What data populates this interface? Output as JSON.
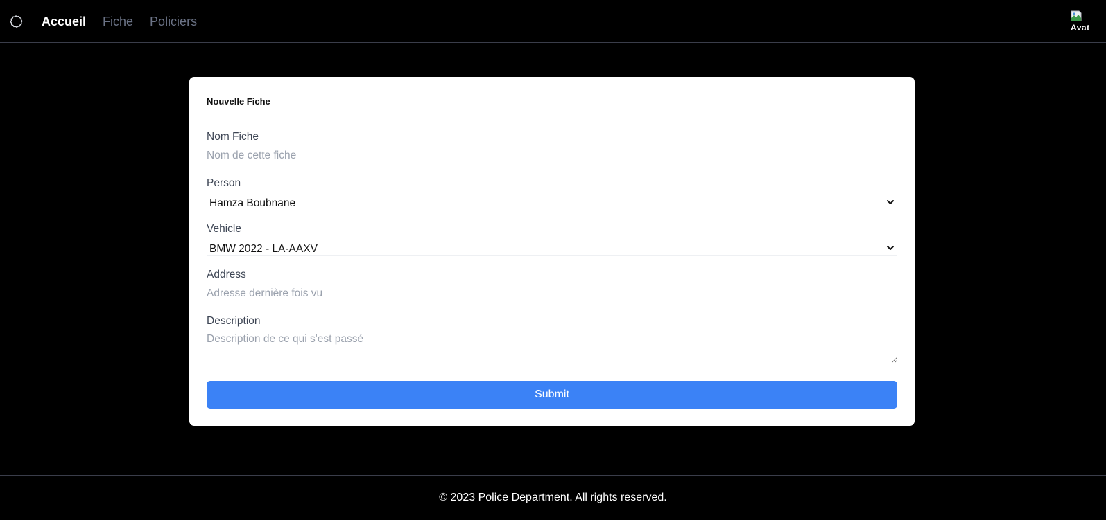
{
  "header": {
    "logo_icon": "gear-icon",
    "nav": [
      {
        "label": "Accueil",
        "active": true
      },
      {
        "label": "Fiche",
        "active": false
      },
      {
        "label": "Policiers",
        "active": false
      }
    ],
    "avatar_alt": "Avat"
  },
  "form": {
    "title": "Nouvelle Fiche",
    "nom_fiche": {
      "label": "Nom Fiche",
      "placeholder": "Nom de cette fiche",
      "value": ""
    },
    "person": {
      "label": "Person",
      "selected": "Hamza Boubnane"
    },
    "vehicle": {
      "label": "Vehicle",
      "selected": "BMW 2022 - LA-AAXV"
    },
    "address": {
      "label": "Address",
      "placeholder": "Adresse dernière fois vu",
      "value": ""
    },
    "description": {
      "label": "Description",
      "placeholder": "Description de ce qui s'est passé",
      "value": ""
    },
    "submit_label": "Submit"
  },
  "footer": {
    "text": "© 2023 Police Department. All rights reserved."
  },
  "colors": {
    "background": "#000000",
    "card": "#ffffff",
    "primary": "#3b82f6",
    "nav_inactive": "#6b7386"
  }
}
